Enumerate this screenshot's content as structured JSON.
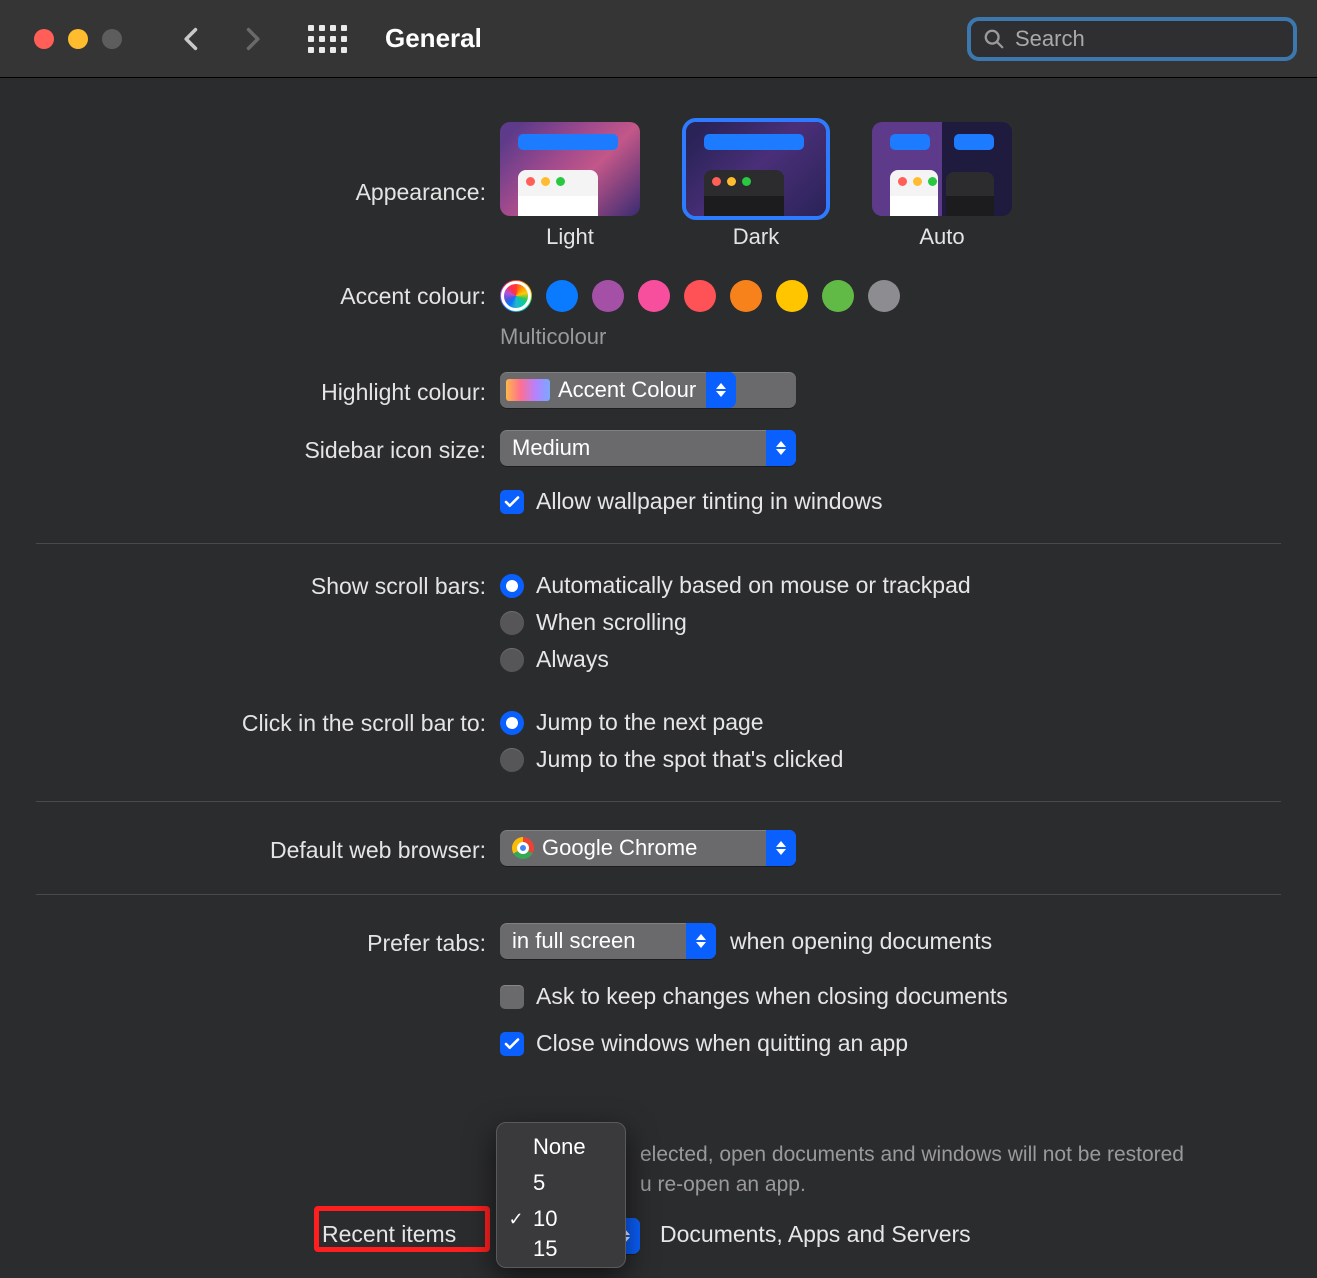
{
  "toolbar": {
    "title": "General",
    "search_placeholder": "Search",
    "traffic": {
      "close": "#ff5f57",
      "min": "#febc2e",
      "max": "#5d5d5d"
    }
  },
  "appearance": {
    "label": "Appearance:",
    "options": [
      "Light",
      "Dark",
      "Auto"
    ],
    "selected": "Dark"
  },
  "accent": {
    "label": "Accent colour:",
    "selected_name": "Multicolour",
    "colors": [
      "multi",
      "#0a7aff",
      "#a550a7",
      "#f74f9e",
      "#ff5257",
      "#f7821b",
      "#ffc600",
      "#62ba46",
      "#8c8c91"
    ]
  },
  "highlight": {
    "label": "Highlight colour:",
    "value": "Accent Colour"
  },
  "sidebar_icon": {
    "label": "Sidebar icon size:",
    "value": "Medium"
  },
  "wallpaper_tint": {
    "label": "Allow wallpaper tinting in windows",
    "checked": true
  },
  "scrollbars": {
    "label": "Show scroll bars:",
    "options": [
      "Automatically based on mouse or trackpad",
      "When scrolling",
      "Always"
    ],
    "selected": 0
  },
  "click_scrollbar": {
    "label": "Click in the scroll bar to:",
    "options": [
      "Jump to the next page",
      "Jump to the spot that's clicked"
    ],
    "selected": 0
  },
  "default_browser": {
    "label": "Default web browser:",
    "value": "Google Chrome"
  },
  "prefer_tabs": {
    "label": "Prefer tabs:",
    "value": "in full screen",
    "suffix": "when opening documents"
  },
  "ask_changes": {
    "label": "Ask to keep changes when closing documents",
    "checked": false
  },
  "close_windows": {
    "label": "Close windows when quitting an app",
    "checked": true,
    "note1_a": "elected, open documents and windows will not be restored",
    "note1_b": "u re-open an app."
  },
  "recent_items": {
    "label": "Recent items",
    "suffix": "Documents, Apps and Servers",
    "menu": [
      "None",
      "5",
      "10",
      "15"
    ],
    "selected_index": 2
  }
}
